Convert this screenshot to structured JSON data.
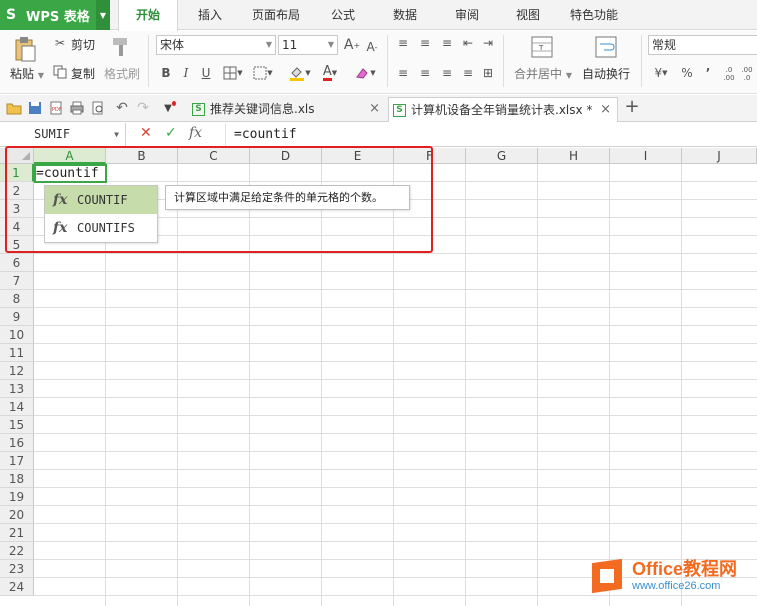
{
  "menubar": {
    "app_title": "WPS 表格",
    "app_logo": "S",
    "tabs": [
      "开始",
      "插入",
      "页面布局",
      "公式",
      "数据",
      "审阅",
      "视图",
      "特色功能"
    ],
    "active_tab": "开始"
  },
  "ribbon": {
    "paste_label": "粘贴",
    "cut_label": "剪切",
    "copy_label": "复制",
    "format_painter_label": "格式刷",
    "font_name": "宋体",
    "font_size": "11",
    "bold": "B",
    "italic": "I",
    "underline": "U",
    "merge_center_label": "合并居中",
    "wrap_text_label": "自动换行",
    "number_format": "常规",
    "percent": "%",
    "comma": "’",
    "dec_inc": ".0 .00",
    "dec_dec": ".00 .0"
  },
  "docbar": {
    "tabs": [
      {
        "name": "推荐关键词信息.xls",
        "active": false
      },
      {
        "name": "计算机设备全年销量统计表.xlsx *",
        "active": true
      }
    ],
    "close_glyph": "×",
    "new_tab_glyph": "+"
  },
  "formula_bar": {
    "name_box": "SUMIF",
    "cancel_glyph": "✕",
    "confirm_glyph": "✓",
    "fx_label": "fx",
    "value": "=countif"
  },
  "sheet": {
    "columns": [
      "A",
      "B",
      "C",
      "D",
      "E",
      "F",
      "G",
      "H",
      "I",
      "J"
    ],
    "rows": [
      "1",
      "2",
      "3",
      "4",
      "5",
      "6",
      "7",
      "8",
      "9",
      "10",
      "11",
      "12",
      "13",
      "14",
      "15",
      "16",
      "17",
      "18",
      "19",
      "20",
      "21",
      "22",
      "23",
      "24"
    ],
    "active_column": "A",
    "active_row": "1",
    "cell_A1": "=countif"
  },
  "autocomplete": {
    "items": [
      {
        "fx": "fx",
        "name": "COUNTIF",
        "selected": true
      },
      {
        "fx": "fx",
        "name": "COUNTIFS",
        "selected": false
      }
    ],
    "tooltip": "计算区域中满足给定条件的单元格的个数。"
  },
  "watermark": {
    "title": "Office教程网",
    "url": "www.office26.com"
  },
  "colors": {
    "accent": "#3aa646",
    "highlight": "#e02020",
    "watermark_orange": "#f36b21"
  }
}
